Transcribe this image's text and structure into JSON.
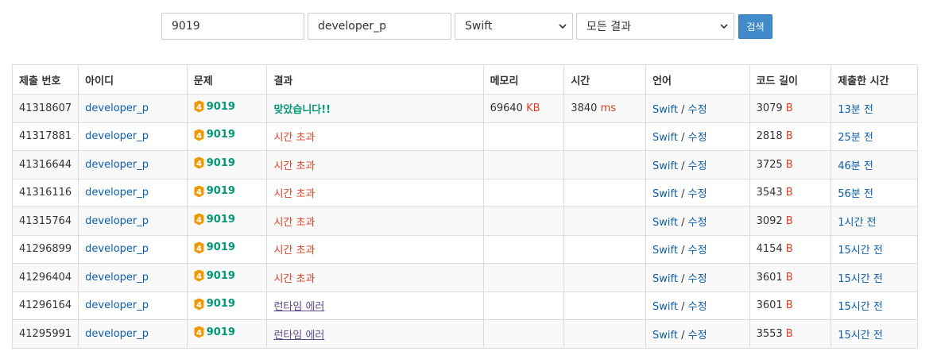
{
  "search": {
    "problem_id": "9019",
    "user_id": "developer_p",
    "language": "Swift",
    "result": "모든 결과",
    "button_label": "검색"
  },
  "table": {
    "headers": [
      "제출 번호",
      "아이디",
      "문제",
      "결과",
      "메모리",
      "시간",
      "언어",
      "코드 길이",
      "제출한 시간"
    ],
    "rows": [
      {
        "id": "41318607",
        "user": "developer_p",
        "tier": "4",
        "problem": "9019",
        "result": "맞았습니다!!",
        "result_type": "ac",
        "memory": "69640",
        "memory_unit": "KB",
        "time": "3840",
        "time_unit": "ms",
        "lang": "Swift",
        "edit": "수정",
        "code_len": "3079",
        "code_unit": "B",
        "submitted": "13분 전"
      },
      {
        "id": "41317881",
        "user": "developer_p",
        "tier": "4",
        "problem": "9019",
        "result": "시간 초과",
        "result_type": "tle",
        "memory": "",
        "memory_unit": "",
        "time": "",
        "time_unit": "",
        "lang": "Swift",
        "edit": "수정",
        "code_len": "2818",
        "code_unit": "B",
        "submitted": "25분 전"
      },
      {
        "id": "41316644",
        "user": "developer_p",
        "tier": "4",
        "problem": "9019",
        "result": "시간 초과",
        "result_type": "tle",
        "memory": "",
        "memory_unit": "",
        "time": "",
        "time_unit": "",
        "lang": "Swift",
        "edit": "수정",
        "code_len": "3725",
        "code_unit": "B",
        "submitted": "46분 전"
      },
      {
        "id": "41316116",
        "user": "developer_p",
        "tier": "4",
        "problem": "9019",
        "result": "시간 초과",
        "result_type": "tle",
        "memory": "",
        "memory_unit": "",
        "time": "",
        "time_unit": "",
        "lang": "Swift",
        "edit": "수정",
        "code_len": "3543",
        "code_unit": "B",
        "submitted": "56분 전"
      },
      {
        "id": "41315764",
        "user": "developer_p",
        "tier": "4",
        "problem": "9019",
        "result": "시간 초과",
        "result_type": "tle",
        "memory": "",
        "memory_unit": "",
        "time": "",
        "time_unit": "",
        "lang": "Swift",
        "edit": "수정",
        "code_len": "3092",
        "code_unit": "B",
        "submitted": "1시간 전"
      },
      {
        "id": "41296899",
        "user": "developer_p",
        "tier": "4",
        "problem": "9019",
        "result": "시간 초과",
        "result_type": "tle",
        "memory": "",
        "memory_unit": "",
        "time": "",
        "time_unit": "",
        "lang": "Swift",
        "edit": "수정",
        "code_len": "4154",
        "code_unit": "B",
        "submitted": "15시간 전"
      },
      {
        "id": "41296404",
        "user": "developer_p",
        "tier": "4",
        "problem": "9019",
        "result": "시간 초과",
        "result_type": "tle",
        "memory": "",
        "memory_unit": "",
        "time": "",
        "time_unit": "",
        "lang": "Swift",
        "edit": "수정",
        "code_len": "3601",
        "code_unit": "B",
        "submitted": "15시간 전"
      },
      {
        "id": "41296164",
        "user": "developer_p",
        "tier": "4",
        "problem": "9019",
        "result": "런타임 에러",
        "result_type": "rte",
        "memory": "",
        "memory_unit": "",
        "time": "",
        "time_unit": "",
        "lang": "Swift",
        "edit": "수정",
        "code_len": "3601",
        "code_unit": "B",
        "submitted": "15시간 전"
      },
      {
        "id": "41295991",
        "user": "developer_p",
        "tier": "4",
        "problem": "9019",
        "result": "런타임 에러",
        "result_type": "rte",
        "memory": "",
        "memory_unit": "",
        "time": "",
        "time_unit": "",
        "lang": "Swift",
        "edit": "수정",
        "code_len": "3553",
        "code_unit": "B",
        "submitted": "15시간 전"
      }
    ]
  },
  "icons": {
    "tier": "gold-tier-icon",
    "dropdown": "chevron-down-icon"
  },
  "colors": {
    "accepted": "#009874",
    "time_limit": "#dd4124",
    "runtime_error": "#5f4b8b",
    "link": "#0b5ea8",
    "tier_gold": "#ec9a00",
    "button": "#428bca"
  }
}
